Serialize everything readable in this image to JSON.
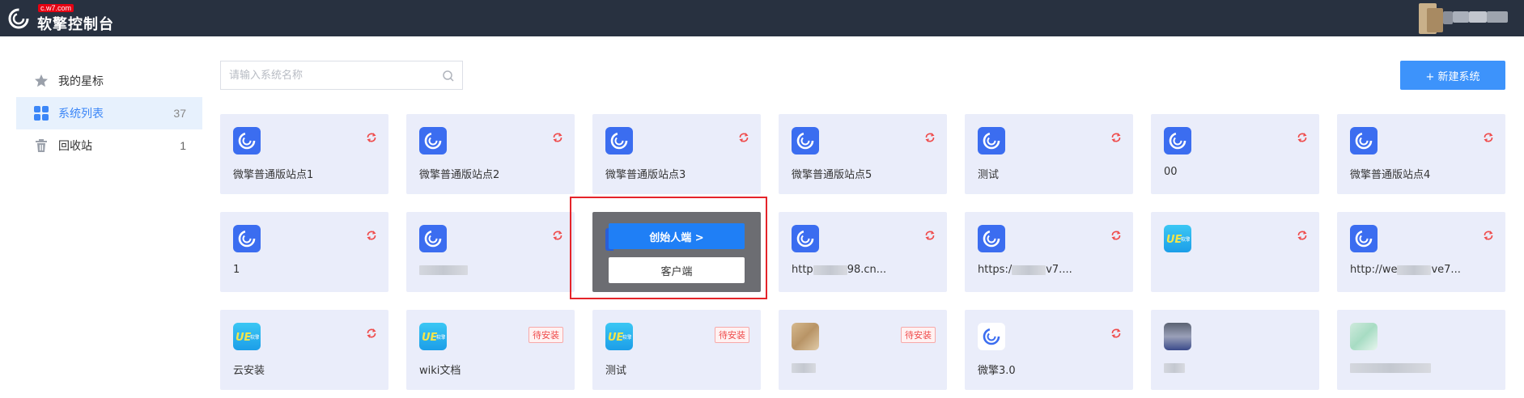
{
  "header": {
    "badge": "c.w7.com",
    "title": "软擎控制台"
  },
  "sidebar": {
    "items": [
      {
        "label": "我的星标",
        "count": "",
        "icon": "star-icon"
      },
      {
        "label": "系统列表",
        "count": "37",
        "icon": "grid-icon"
      },
      {
        "label": "回收站",
        "count": "1",
        "icon": "trash-icon"
      }
    ]
  },
  "search": {
    "placeholder": "请输入系统名称"
  },
  "toolbar": {
    "new_label": "+ 新建系统"
  },
  "colors": {
    "topbar": "#283140",
    "accent": "#3d93fb",
    "card_bg": "#eaedfa",
    "danger": "#ef4b4b"
  },
  "cards": [
    {
      "name": "微擎普通版站点1",
      "status": "sync"
    },
    {
      "name": "微擎普通版站点2",
      "status": "sync"
    },
    {
      "name": "微擎普通版站点3",
      "status": "sync"
    },
    {
      "name": "微擎普通版站点5",
      "status": "sync"
    },
    {
      "name": "测试",
      "status": "sync"
    },
    {
      "name": "00",
      "status": "sync"
    },
    {
      "name": "微擎普通版站点4",
      "status": "sync"
    },
    {
      "name": "1",
      "status": "sync"
    },
    {
      "name": "",
      "status": "sync"
    },
    {
      "name": "",
      "status": "overlay"
    },
    {
      "name_prefix": "http",
      "name_suffix": "98.cn...",
      "status": "sync"
    },
    {
      "name_prefix": "https:/",
      "name_suffix": "v7....",
      "status": "sync"
    },
    {
      "name": "",
      "status": "sync"
    },
    {
      "name_prefix": "http://we",
      "name_suffix": "ve7...",
      "status": "sync"
    },
    {
      "name": "云安装",
      "status": "sync"
    },
    {
      "name": "wiki文档",
      "status": "pending"
    },
    {
      "name": "测试",
      "status": "pending"
    },
    {
      "name": "",
      "status": "pending"
    },
    {
      "name": "微擎3.0",
      "status": "sync"
    },
    {
      "name": "",
      "status": "none"
    },
    {
      "name": "",
      "status": "none"
    }
  ],
  "pending_label": "待安装",
  "overlay": {
    "founder_label": "创始人端 >",
    "client_label": "客户端"
  }
}
